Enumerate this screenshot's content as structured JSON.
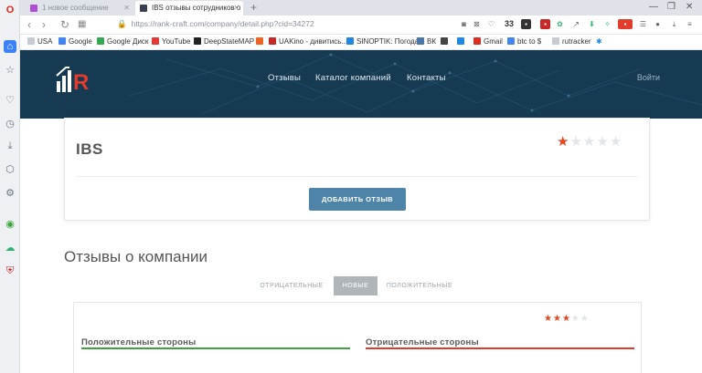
{
  "browser": {
    "tabs": [
      {
        "title": "1 новое сообщение",
        "favicon_color": "#b04bd8",
        "active": false
      },
      {
        "title": "IBS отзывы сотрудников о",
        "favicon_color": "#3a3f55",
        "active": true
      }
    ],
    "new_tab_glyph": "+",
    "window_controls": [
      "—",
      "❐",
      "✕"
    ],
    "url": "https://rank-craft.com/company/detail.php?cid=34272",
    "extension_count": "33",
    "bookmarks": [
      {
        "label": "USA",
        "icon_color": "#c7cbd1"
      },
      {
        "label": "Google",
        "icon_color": "#4285f4"
      },
      {
        "label": "Google Диск",
        "icon_color": "#34a853"
      },
      {
        "label": "YouTube",
        "icon_color": "#e53935"
      },
      {
        "label": "DeepStateMAP",
        "icon_color": "#222222"
      },
      {
        "label": "",
        "icon_color": "#f06423"
      },
      {
        "label": "UAKino - дивитись...",
        "icon_color": "#c62828"
      },
      {
        "label": "SINOPTIK: Погода...",
        "icon_color": "#1e88e5"
      },
      {
        "label": "ВК",
        "icon_color": "#4a76a8"
      },
      {
        "label": "",
        "icon_color": "#444444"
      },
      {
        "label": "",
        "icon_color": "#1e88e5"
      },
      {
        "label": "Gmail",
        "icon_color": "#d93025"
      },
      {
        "label": "btc to $",
        "icon_color": "#4285f4"
      },
      {
        "label": "rutracker",
        "icon_color": "#c7cbd1"
      }
    ]
  },
  "site": {
    "nav": [
      "Отзывы",
      "Каталог компаний",
      "Контакты"
    ],
    "login": "Войти",
    "brand_color": "#163a52",
    "accent_color": "#e8451f"
  },
  "company": {
    "name": "IBS",
    "rating": 1,
    "rating_max": 5,
    "add_review_label": "ДОБАВИТЬ ОТЗЫВ"
  },
  "reviews": {
    "section_title": "Отзывы о компании",
    "filters": [
      {
        "label": "ОТРИЦАТЕЛЬНЫЕ",
        "active": false
      },
      {
        "label": "НОВЫЕ",
        "active": true
      },
      {
        "label": "ПОЛОЖИТЕЛЬНЫЕ",
        "active": false
      }
    ],
    "first_review": {
      "rating": 3,
      "rating_max": 5,
      "positive_title": "Положительные стороны",
      "negative_title": "Отрицательные стороны",
      "positive_color": "#3aa63a",
      "negative_color": "#e03b2d"
    }
  }
}
